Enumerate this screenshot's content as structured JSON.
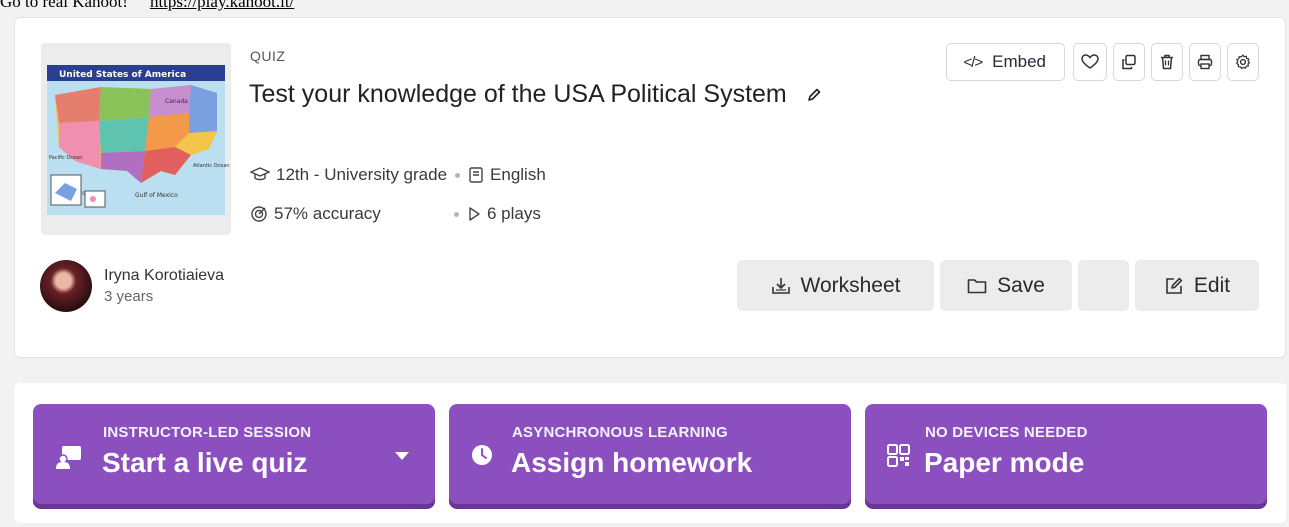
{
  "top_banner": {
    "text": "Go to real Kahoot!",
    "link": "https://play.kahoot.it/"
  },
  "quiz": {
    "type_label": "QUIZ",
    "title": "Test your knowledge of the USA Political System",
    "grade": "12th - University grade",
    "language": "English",
    "accuracy": "57% accuracy",
    "plays": "6 plays"
  },
  "thumbnail": {
    "caption_top": "United States of America",
    "caption_canada": "Canada",
    "caption_mexico": "Mexico",
    "caption_gulf": "Gulf of Mexico",
    "caption_pacific": "Pacific Ocean",
    "caption_atlantic": "Atlantic Ocean"
  },
  "toolbar": {
    "embed_label": "Embed"
  },
  "author": {
    "name": "Iryna Korotiaieva",
    "time": "3 years"
  },
  "actions": {
    "worksheet": "Worksheet",
    "save": "Save",
    "edit": "Edit"
  },
  "modes": [
    {
      "small": "INSTRUCTOR-LED SESSION",
      "big": "Start a live quiz"
    },
    {
      "small": "ASYNCHRONOUS LEARNING",
      "big": "Assign homework"
    },
    {
      "small": "NO DEVICES NEEDED",
      "big": "Paper mode"
    }
  ],
  "colors": {
    "accent": "#8b4fc0",
    "accent_shadow": "#6a3596"
  }
}
